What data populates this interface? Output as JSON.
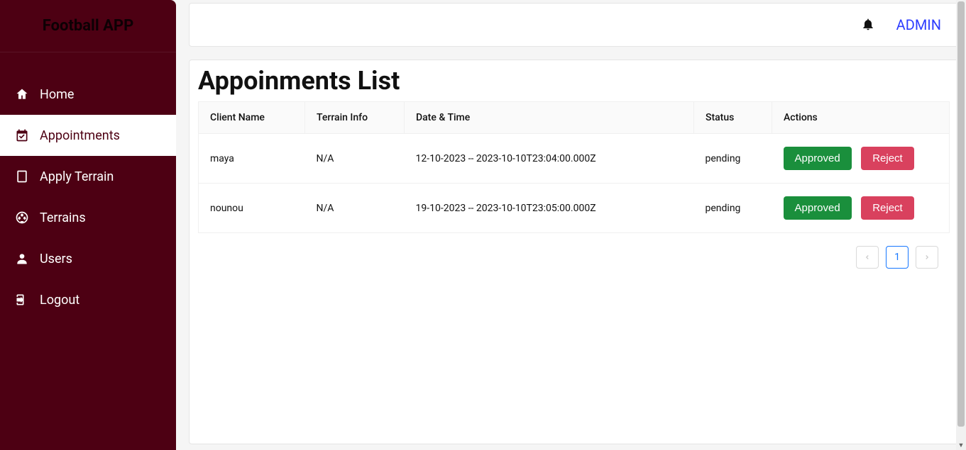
{
  "app_title": "Football APP",
  "sidebar": {
    "items": [
      {
        "label": "Home"
      },
      {
        "label": "Appointments"
      },
      {
        "label": "Apply Terrain"
      },
      {
        "label": "Terrains"
      },
      {
        "label": "Users"
      },
      {
        "label": "Logout"
      }
    ]
  },
  "topbar": {
    "user_label": "ADMIN"
  },
  "page": {
    "title": "Appoinments List"
  },
  "table": {
    "headers": {
      "client": "Client Name",
      "terrain": "Terrain Info",
      "datetime": "Date & Time",
      "status": "Status",
      "actions": "Actions"
    },
    "rows": [
      {
        "client": "maya",
        "terrain": "N/A",
        "datetime": "12-10-2023  -- 2023-10-10T23:04:00.000Z",
        "status": "pending"
      },
      {
        "client": "nounou",
        "terrain": "N/A",
        "datetime": "19-10-2023  -- 2023-10-10T23:05:00.000Z",
        "status": "pending"
      }
    ],
    "actions": {
      "approve": "Approved",
      "reject": "Reject"
    }
  },
  "pagination": {
    "current": "1"
  }
}
